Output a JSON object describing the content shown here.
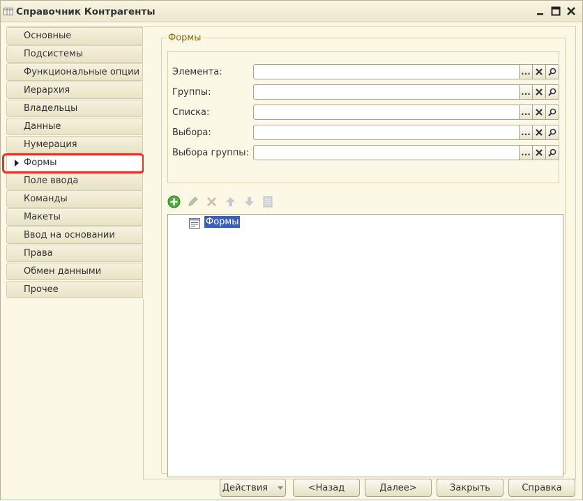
{
  "window": {
    "title": "Справочник Контрагенты",
    "icons": [
      "table-icon",
      "minimize-icon",
      "maximize-icon",
      "close-icon"
    ]
  },
  "sidebar": {
    "items": [
      {
        "label": "Основные"
      },
      {
        "label": "Подсистемы"
      },
      {
        "label": "Функциональные опции"
      },
      {
        "label": "Иерархия"
      },
      {
        "label": "Владельцы"
      },
      {
        "label": "Данные"
      },
      {
        "label": "Нумерация"
      },
      {
        "label": "Формы",
        "active": true
      },
      {
        "label": "Поле ввода"
      },
      {
        "label": "Команды"
      },
      {
        "label": "Макеты"
      },
      {
        "label": "Ввод на основании"
      },
      {
        "label": "Права"
      },
      {
        "label": "Обмен данными"
      },
      {
        "label": "Прочее"
      }
    ]
  },
  "main": {
    "group_title": "Формы",
    "fields": [
      {
        "label": "Элемента:",
        "value": ""
      },
      {
        "label": "Группы:",
        "value": ""
      },
      {
        "label": "Списка:",
        "value": ""
      },
      {
        "label": "Выбора:",
        "value": ""
      },
      {
        "label": "Выбора группы:",
        "value": ""
      }
    ],
    "field_buttons": {
      "select": "...",
      "icons": [
        "clear-icon",
        "search-icon"
      ]
    },
    "toolbar_icons": [
      "add-icon",
      "edit-icon",
      "delete-icon",
      "move-up-icon",
      "move-down-icon",
      "properties-icon"
    ],
    "tree": {
      "root_label": "Формы",
      "root_icon": "form-icon",
      "selected": true
    }
  },
  "buttons": {
    "actions": "Действия",
    "back": "<Назад",
    "next": "Далее>",
    "close": "Закрыть",
    "help": "Справка"
  },
  "colors": {
    "background": "#fbf8e6",
    "highlight_border": "#e0352b",
    "selection": "#3a5fba",
    "group_title": "#8a6b12"
  }
}
